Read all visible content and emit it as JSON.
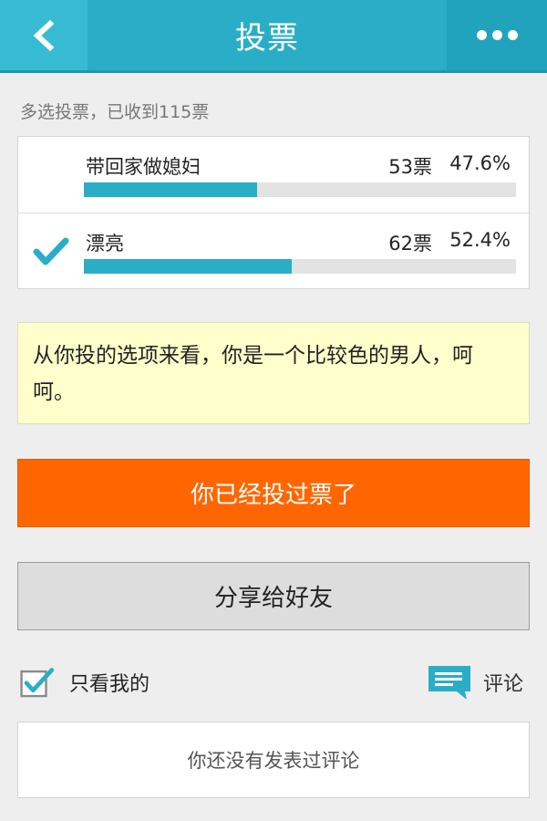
{
  "header": {
    "title": "投票",
    "back_icon": "chevron-left-icon",
    "more_icon": "more-dots-icon"
  },
  "summary": "多选投票，已收到115票",
  "poll": {
    "options": [
      {
        "label": "带回家做媳妇",
        "votes": "53票",
        "percent": "47.6%",
        "fill": 0.4,
        "selected": false
      },
      {
        "label": "漂亮",
        "votes": "62票",
        "percent": "52.4%",
        "fill": 0.48,
        "selected": true
      }
    ]
  },
  "note": "从你投的选项来看，你是一个比较色的男人，呵呵。",
  "buttons": {
    "voted_label": "你已经投过票了",
    "share_label": "分享给好友"
  },
  "filter": {
    "label": "只看我的",
    "checked": true
  },
  "comment": {
    "label": "评论",
    "empty_text": "你还没有发表过评论"
  },
  "colors": {
    "accent": "#2aaec8",
    "orange": "#ff6600",
    "note_bg": "#ffffcc"
  }
}
